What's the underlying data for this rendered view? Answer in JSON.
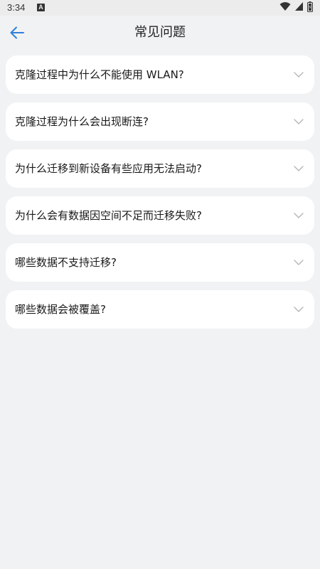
{
  "status_bar": {
    "time": "3:34",
    "notification_badge": "A",
    "icons": [
      "wifi-icon",
      "signal-icon",
      "battery-icon"
    ]
  },
  "header": {
    "back_icon": "arrow-left-icon",
    "title": "常见问题"
  },
  "faq": {
    "items": [
      {
        "label": "克隆过程中为什么不能使用 WLAN?"
      },
      {
        "label": "克隆过程为什么会出现断连?"
      },
      {
        "label": "为什么迁移到新设备有些应用无法启动?"
      },
      {
        "label": "为什么会有数据因空间不足而迁移失败?"
      },
      {
        "label": "哪些数据不支持迁移?"
      },
      {
        "label": "哪些数据会被覆盖?"
      }
    ],
    "expand_icon": "chevron-down-icon"
  },
  "colors": {
    "background": "#f1f2f4",
    "card": "#ffffff",
    "accent": "#2f7fd8",
    "chevron": "#b5b5b5"
  }
}
